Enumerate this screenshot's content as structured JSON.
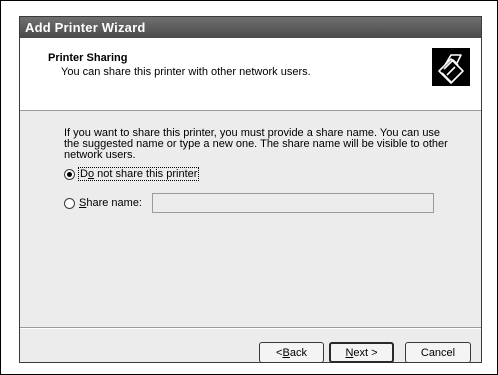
{
  "window": {
    "title": "Add Printer Wizard"
  },
  "header": {
    "title": "Printer Sharing",
    "subtitle": "You can share this printer with other network users.",
    "icon": "printer-sharing-icon"
  },
  "body": {
    "description": "If you want to share this printer, you must provide a share name. You can use the suggested name or type a new one. The share name will be visible to other network users."
  },
  "options": {
    "do_not_share": {
      "mnemonic": "o",
      "before": "D",
      "after": " not share this printer",
      "selected": true
    },
    "share_name": {
      "mnemonic": "S",
      "before": "",
      "after": "hare name:",
      "selected": false,
      "value": ""
    }
  },
  "buttons": {
    "back": {
      "prefix": "< ",
      "mnemonic": "B",
      "rest": "ack"
    },
    "next": {
      "prefix": "",
      "mnemonic": "N",
      "rest": "ext >"
    },
    "cancel": {
      "label": "Cancel"
    }
  }
}
